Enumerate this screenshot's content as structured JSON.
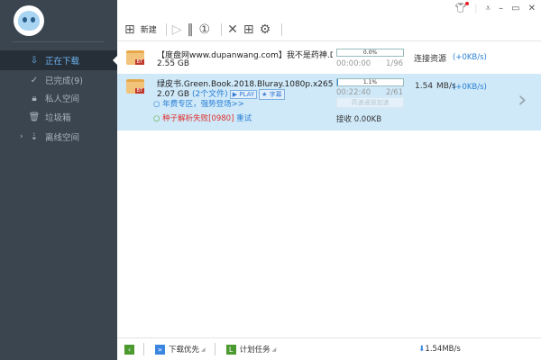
{
  "window": {
    "icons": [
      "skin-icon",
      "menu-icon",
      "minimize-icon",
      "maximize-icon",
      "close-icon"
    ],
    "notify_color": "#e8202a"
  },
  "sidebar": {
    "items": [
      {
        "label": "正在下载",
        "icon": "download-icon",
        "selected": true
      },
      {
        "label": "已完成(9)",
        "icon": "check-circle-icon"
      },
      {
        "label": "私人空间",
        "icon": "lock-icon"
      },
      {
        "label": "垃圾箱",
        "icon": "trash-icon"
      },
      {
        "label": "离线空间",
        "icon": "cloud-download-icon",
        "expandable": true
      }
    ]
  },
  "toolbar": {
    "new_label": "新建"
  },
  "tasks": [
    {
      "name": "【度盘网www.dupanwang.com】我不是药神.Drug.Deal...",
      "size": "2.55 GB",
      "progress_label": "0.0%",
      "progress": 0.0,
      "time": "00:00:00",
      "pieces": "1/96",
      "status": "连接资源",
      "boost": "(+0KB/s)",
      "badge": "BT"
    },
    {
      "name": "绿皮书.Green.Book.2018.Bluray.1080p.x265.AAC(5.1).G...",
      "size": "2.07 GB",
      "files": "(2个文件)",
      "play": "PLAY",
      "subtitle": "字幕",
      "progress_label": "1.1%",
      "progress": 1.1,
      "time": "00:22:40",
      "pieces": "2/61",
      "speed": "1.54",
      "speed_unit": "MB/s",
      "boost": "(+0KB/s)",
      "promo": "年费专区，强势登场>>",
      "error": "种子解析失败[0980]",
      "retry": "重试",
      "accel_button": "高速通道加速",
      "received": "接收 0.00KB",
      "badge": "BT"
    }
  ],
  "footer": {
    "priority": "下载优先",
    "schedule": "计划任务",
    "total_speed": "1.54MB/s"
  }
}
